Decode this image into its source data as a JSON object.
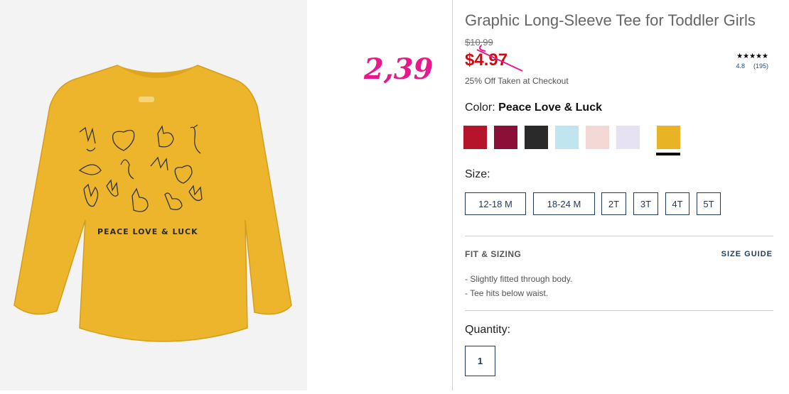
{
  "product": {
    "title": "Graphic Long-Sleeve Tee for Toddler Girls",
    "original_price": "$10.99",
    "sale_price": "$4.97",
    "promo_text": "25% Off Taken at Checkout",
    "rating_stars": "★★★★★",
    "rating_value": "4.8",
    "rating_count": "(195)",
    "shirt_print_text": "PEACE LOVE & LUCK"
  },
  "annotation": {
    "handwritten_price": "2,39"
  },
  "color": {
    "label": "Color:",
    "selected": "Peace Love & Luck",
    "swatches": [
      {
        "color": "#b5142a"
      },
      {
        "color": "#8a1038"
      },
      {
        "color": "#2a2a2a"
      },
      {
        "color": "#bfe6ef"
      },
      {
        "color": "#f4d8d6"
      },
      {
        "color": "#e7e2f3"
      },
      {
        "color": "#e9b326",
        "selected": true
      }
    ]
  },
  "size": {
    "label": "Size:",
    "options": [
      "12-18 M",
      "18-24 M",
      "2T",
      "3T",
      "4T",
      "5T"
    ]
  },
  "fit": {
    "heading": "FIT & SIZING",
    "size_guide": "SIZE GUIDE",
    "points": [
      "-  Slightly fitted through body.",
      "-  Tee hits below waist."
    ]
  },
  "quantity": {
    "label": "Quantity:",
    "value": "1"
  }
}
